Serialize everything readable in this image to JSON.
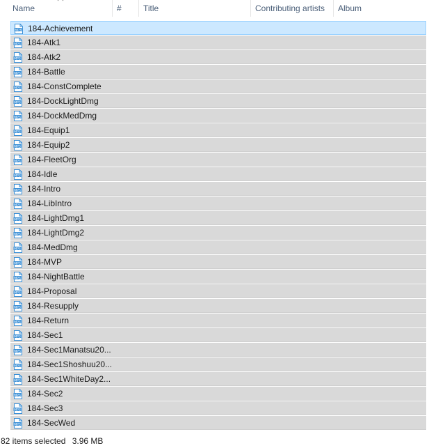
{
  "columns": {
    "name": "Name",
    "number": "#",
    "title": "Title",
    "contributing_artists": "Contributing artists",
    "album": "Album"
  },
  "icons": {
    "sort_indicator": "chevron-up-icon",
    "file": "mp3-file-icon",
    "file_badge": "MP3",
    "file_color": "#3a8fd6"
  },
  "files": [
    "184-Achievement",
    "184-Atk1",
    "184-Atk2",
    "184-Battle",
    "184-ConstComplete",
    "184-DockLightDmg",
    "184-DockMedDmg",
    "184-Equip1",
    "184-Equip2",
    "184-FleetOrg",
    "184-Idle",
    "184-Intro",
    "184-LibIntro",
    "184-LightDmg1",
    "184-LightDmg2",
    "184-MedDmg",
    "184-MVP",
    "184-NightBattle",
    "184-Proposal",
    "184-Resupply",
    "184-Return",
    "184-Sec1",
    "184-Sec1Manatsu20...",
    "184-Sec1Shoshuu20...",
    "184-Sec1WhiteDay2...",
    "184-Sec2",
    "184-Sec3",
    "184-SecWed"
  ],
  "focused_index": 0,
  "status_bar": {
    "selection": "82 items selected",
    "size": "3.96 MB"
  }
}
